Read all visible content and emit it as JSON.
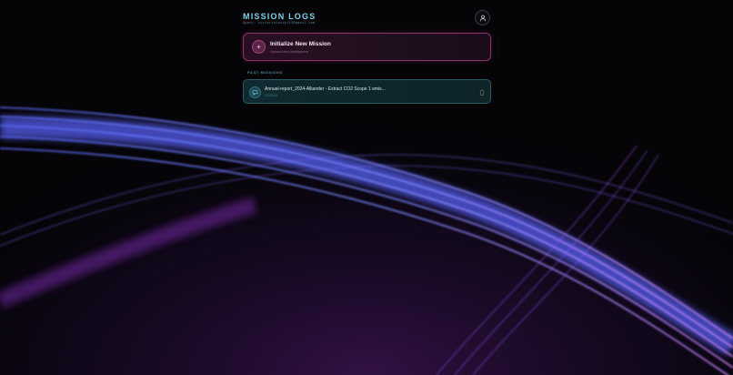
{
  "app": {
    "title": "MISSION LOGS",
    "agent_line": "Agent: victorialaure123@gmail.com"
  },
  "header": {
    "profile_icon": "user-icon"
  },
  "new_mission": {
    "label": "Initialize New Mission",
    "sublabel": "Upload new intelligence",
    "icon": "plus-icon"
  },
  "past_missions": {
    "section_label": "PAST MISSIONS",
    "items": [
      {
        "title": "Annual-report_2024-Alliander - Extract CO2 Scope 1 emis...",
        "date": "2/2/2026",
        "icon": "chat-icon",
        "delete_icon": "trash-icon"
      }
    ]
  },
  "colors": {
    "accent_cyan": "#7fd3ea",
    "accent_magenta": "#a2437e",
    "background": "#050407",
    "wave_blue": "#6b7bff",
    "wave_violet": "#c77dff"
  }
}
